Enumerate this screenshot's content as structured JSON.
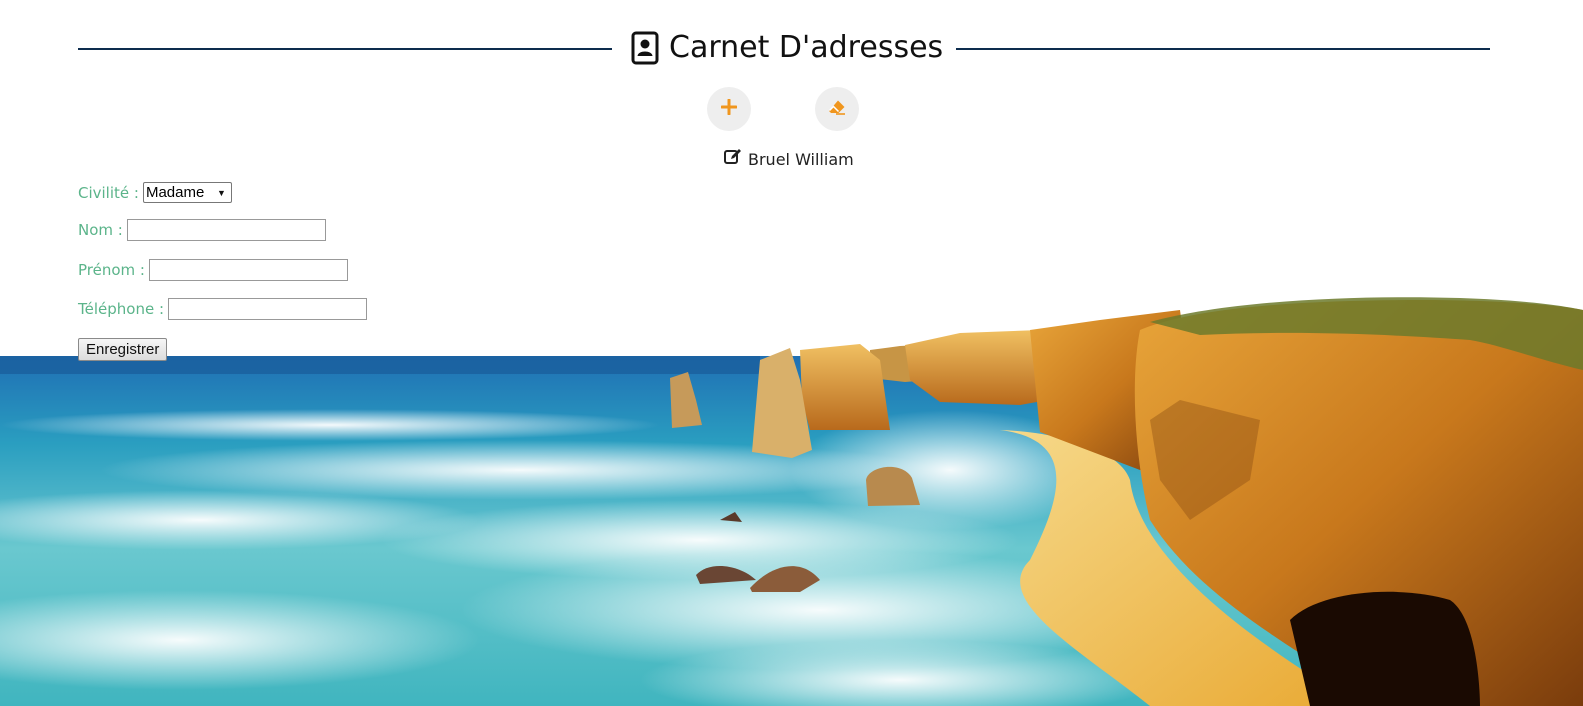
{
  "header": {
    "title": "Carnet D'adresses",
    "icon": "address-book-icon",
    "rule_color": "#0d2c4d"
  },
  "actions": {
    "add_icon": "plus-icon",
    "erase_icon": "eraser-icon",
    "accent_color": "#f0961e"
  },
  "current_contact": {
    "icon": "edit-icon",
    "name": "Bruel William"
  },
  "form": {
    "label_color": "#5bb48a",
    "civilite": {
      "label": "Civilité :",
      "selected": "Madame",
      "options": [
        "Madame"
      ]
    },
    "nom": {
      "label": "Nom :",
      "value": ""
    },
    "prenom": {
      "label": "Prénom :",
      "value": ""
    },
    "telephone": {
      "label": "Téléphone :",
      "value": ""
    },
    "submit_label": "Enregistrer"
  }
}
